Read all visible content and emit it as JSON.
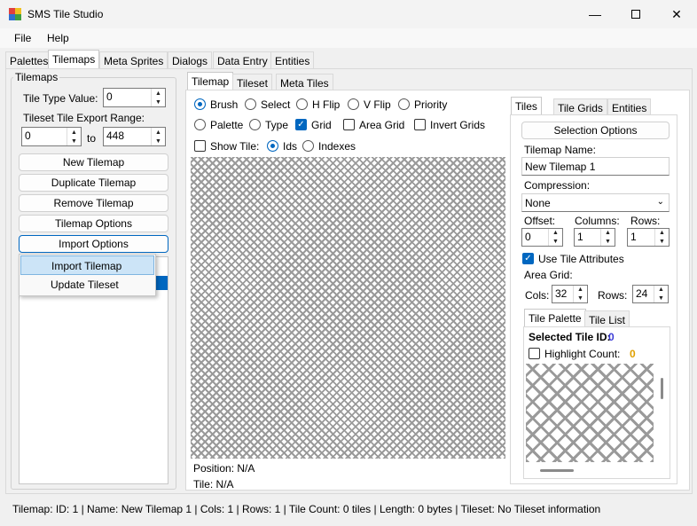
{
  "window": {
    "title": "SMS Tile Studio",
    "icon": "app-icon",
    "controls": [
      "minimize-icon",
      "maximize-icon",
      "close-icon"
    ]
  },
  "menu": {
    "file": "File",
    "help": "Help"
  },
  "main_tabs": [
    "Palettes",
    "Tilemaps",
    "Meta Sprites",
    "Dialogs",
    "Data Entry",
    "Entities"
  ],
  "left": {
    "group_title": "Tilemaps",
    "tile_type_label": "Tile Type Value:",
    "tile_type_value": "0",
    "export_range_label": "Tileset Tile Export Range:",
    "range_from": "0",
    "range_to_label": "to",
    "range_to": "448",
    "buttons": {
      "new": "New Tilemap",
      "duplicate": "Duplicate Tilemap",
      "remove": "Remove Tilemap",
      "options": "Tilemap Options",
      "import": "Import Options"
    },
    "import_menu": {
      "import_tilemap": "Import Tilemap",
      "update_tileset": "Update Tileset"
    }
  },
  "center": {
    "tabs": [
      "Tilemap",
      "Tileset",
      "Meta Tiles"
    ],
    "tools": {
      "brush": "Brush",
      "select": "Select",
      "hflip": "H Flip",
      "vflip": "V Flip",
      "priority": "Priority",
      "palette": "Palette",
      "type": "Type"
    },
    "toggles": {
      "grid": "Grid",
      "area_grid": "Area Grid",
      "invert_grids": "Invert Grids",
      "show_tile": "Show Tile:"
    },
    "show_mode": {
      "ids": "Ids",
      "indexes": "Indexes"
    },
    "position": "Position: N/A",
    "tile": "Tile: N/A"
  },
  "right": {
    "tabs": [
      "Tiles",
      "Tile Grids",
      "Entities"
    ],
    "selection_options": "Selection Options",
    "tilemap_name_label": "Tilemap Name:",
    "tilemap_name": "New Tilemap 1",
    "compression_label": "Compression:",
    "compression": "None",
    "offset_label": "Offset:",
    "columns_label": "Columns:",
    "rows_label": "Rows:",
    "offset": "0",
    "columns": "1",
    "rows": "1",
    "use_tile_attributes": "Use Tile Attributes",
    "area_grid_label": "Area Grid:",
    "cols_label": "Cols:",
    "cols": "32",
    "rows2_label": "Rows:",
    "rows2": "24",
    "sub_tabs": [
      "Tile Palette",
      "Tile List"
    ],
    "selected_tile_label": "Selected Tile ID:",
    "selected_tile_value": "0",
    "highlight_count_label": "Highlight Count:",
    "highlight_count_value": "0"
  },
  "status": "Tilemap: ID: 1 | Name: New Tilemap 1 | Cols: 1 | Rows: 1 | Tile Count: 0 tiles | Length: 0 bytes | Tileset: No Tileset information",
  "colors": {
    "accent": "#0067c0",
    "selected_id": "#3b3bd6",
    "highlight_count": "#e0a000"
  }
}
